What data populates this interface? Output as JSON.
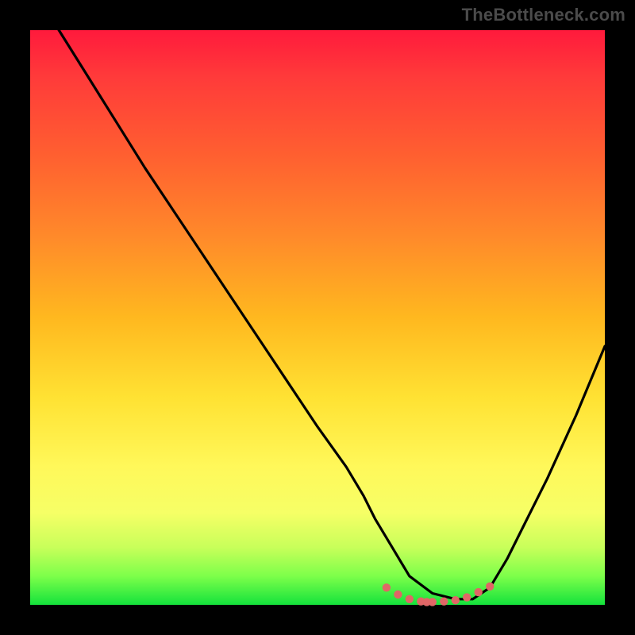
{
  "watermark": "TheBottleneck.com",
  "colors": {
    "page_bg": "#000000",
    "gradient_top": "#ff1a3c",
    "gradient_bottom": "#14e23c",
    "curve_stroke": "#000000",
    "dots_fill": "#e06666"
  },
  "chart_data": {
    "type": "line",
    "title": "",
    "xlabel": "",
    "ylabel": "",
    "xlim": [
      0,
      100
    ],
    "ylim": [
      0,
      100
    ],
    "note": "Values estimated from pixels; y=0 is bottom (green), y=100 is top (red). Curve shows bottleneck severity vs some x parameter; minimum ~0 near x≈70.",
    "series": [
      {
        "name": "black-curve",
        "x": [
          0,
          5,
          10,
          15,
          20,
          25,
          30,
          35,
          40,
          45,
          50,
          55,
          58,
          60,
          63,
          66,
          70,
          74,
          77,
          80,
          83,
          86,
          90,
          95,
          100
        ],
        "values": [
          120,
          100,
          92,
          84,
          76,
          68.5,
          61,
          53.5,
          46,
          38.5,
          31,
          24,
          19,
          15,
          10,
          5,
          2,
          1,
          1,
          3,
          8,
          14,
          22,
          33,
          45
        ]
      }
    ],
    "markers": {
      "name": "pink-dots",
      "x": [
        62,
        64,
        66,
        68,
        69,
        70,
        72,
        74,
        76,
        78,
        80
      ],
      "values": [
        3.0,
        1.8,
        1.0,
        0.6,
        0.5,
        0.5,
        0.6,
        0.8,
        1.3,
        2.2,
        3.2
      ]
    }
  }
}
